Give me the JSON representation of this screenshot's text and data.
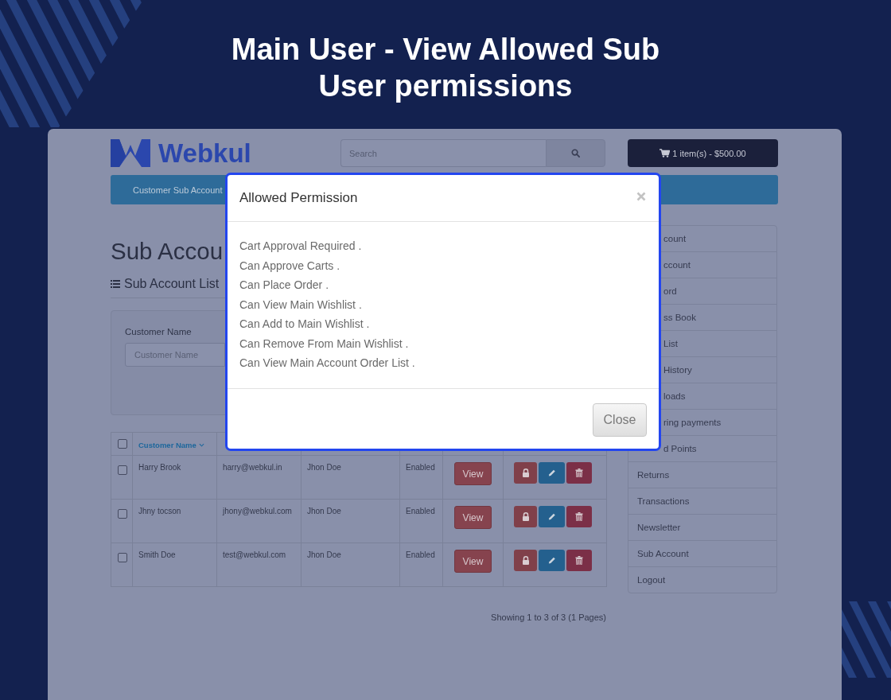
{
  "title": "Main User - View Allowed Sub User permissions",
  "header": {
    "logo_text": "Webkul",
    "search": {
      "placeholder": "Search"
    },
    "cart": {
      "label": "1 item(s) - $500.00"
    }
  },
  "nav_bar": {
    "label": "Customer Sub Account"
  },
  "page": {
    "heading": "Sub Accou",
    "section_title": "Sub Account List",
    "filter": {
      "label": "Customer Name",
      "placeholder": "Customer Name"
    }
  },
  "table": {
    "select_all": {
      "checked": false
    },
    "columns": [
      {
        "label": "Customer Name",
        "sorted": true
      }
    ],
    "rows": [
      {
        "checked": false,
        "customer_name": "Harry Brook",
        "column_3": "harry@webkul.in",
        "column_4": "Jhon Doe",
        "column_5": "Enabled",
        "button": "View"
      },
      {
        "checked": false,
        "customer_name": "Jhny tocson",
        "column_3": "jhony@webkul.com",
        "column_4": "Jhon Doe",
        "column_5": "Enabled",
        "button": "View"
      },
      {
        "checked": false,
        "customer_name": "Smith Doe",
        "column_3": "test@webkul.com",
        "column_4": "Jhon Doe",
        "column_5": "Enabled",
        "button": "View"
      }
    ],
    "footer": "Showing 1 to 3 of 3 (1 Pages)"
  },
  "sidebar": {
    "items": [
      {
        "label": "count",
        "partly_covered": true
      },
      {
        "label": "ccount",
        "partly_covered": true
      },
      {
        "label": "ord",
        "partly_covered": true
      },
      {
        "label": "ss Book",
        "partly_covered": true
      },
      {
        "label": "List",
        "partly_covered": true
      },
      {
        "label": "History",
        "partly_covered": true
      },
      {
        "label": "loads",
        "partly_covered": true
      },
      {
        "label": "ring payments",
        "partly_covered": true
      },
      {
        "label": "d Points",
        "partly_covered": true
      },
      {
        "label": "Returns",
        "partly_covered": false
      },
      {
        "label": "Transactions",
        "partly_covered": false
      },
      {
        "label": "Newsletter",
        "partly_covered": false
      },
      {
        "label": "Sub Account",
        "partly_covered": false
      },
      {
        "label": "Logout",
        "partly_covered": false
      }
    ]
  },
  "modal": {
    "title": "Allowed Permission",
    "permissions": [
      "Cart Approval Required .",
      "Can Approve Carts .",
      "Can Place Order .",
      "Can View Main Wishlist .",
      "Can Add to Main Wishlist .",
      "Can Remove From Main Wishlist .",
      "Can View Main Account Order List ."
    ],
    "close_button": "Close"
  }
}
